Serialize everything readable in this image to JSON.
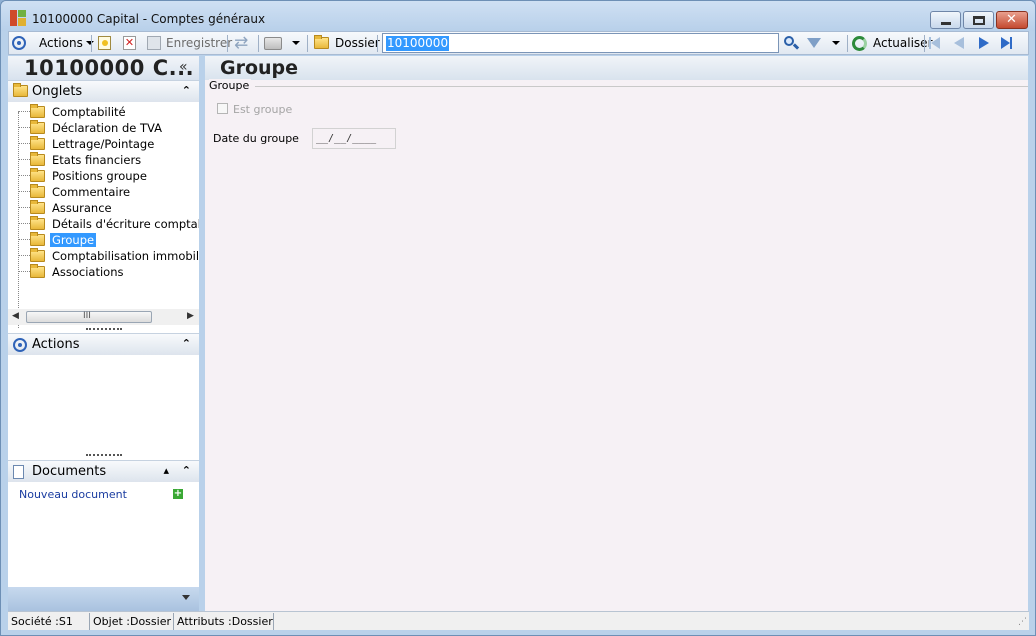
{
  "window": {
    "title": "10100000 Capital -  Comptes généraux",
    "controls": [
      "minimize",
      "maximize",
      "close"
    ]
  },
  "toolbar": {
    "actions_label": "Actions",
    "save_label": "Enregistrer",
    "dossier_label": "Dossier",
    "search_value": "10100000",
    "refresh_label": "Actualiser"
  },
  "left_panel": {
    "header_title": "10100000 C...",
    "collapse_glyph": "«",
    "onglets_title": "Onglets",
    "tabs": [
      {
        "label": "Comptabilité"
      },
      {
        "label": "Déclaration de TVA"
      },
      {
        "label": "Lettrage/Pointage"
      },
      {
        "label": "Etats financiers"
      },
      {
        "label": "Positions groupe"
      },
      {
        "label": "Commentaire"
      },
      {
        "label": "Assurance"
      },
      {
        "label": "Détails d'écriture comptab"
      },
      {
        "label": "Groupe",
        "selected": true
      },
      {
        "label": "Comptabilisation immobili"
      },
      {
        "label": "Associations"
      }
    ],
    "scroll_thumb_label": "III",
    "actions_title": "Actions",
    "documents_title": "Documents",
    "new_document_label": "Nouveau document"
  },
  "main": {
    "title": "Groupe",
    "group_label": "Groupe",
    "checkbox_label": "Est groupe",
    "checkbox_checked": false,
    "date_label": "Date du groupe",
    "date_value": "__/__/____"
  },
  "statusbar": {
    "societe": "Société :S1",
    "objet": "Objet :Dossier",
    "attributs": "Attributs :Dossier"
  },
  "colors": {
    "selection": "#3399ff",
    "main_bg": "#f6f1f5",
    "window_frame": "#b9d1ea"
  }
}
